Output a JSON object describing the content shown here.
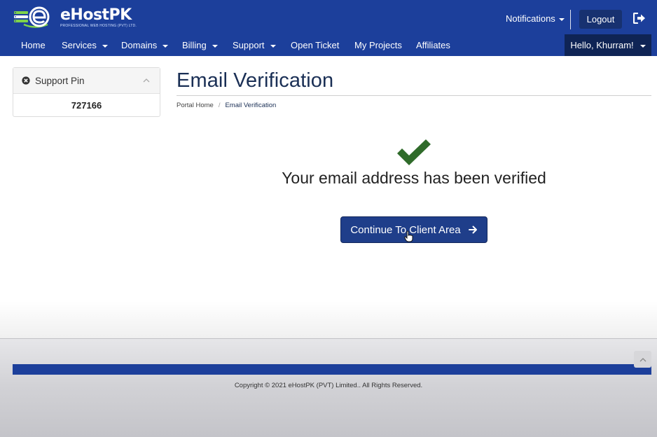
{
  "brand": {
    "name": "eHostPK",
    "tagline": "PROFESSIONAL WEB HOSTING (PVT) LTD."
  },
  "header": {
    "notifications_label": "Notifications",
    "logout_label": "Logout"
  },
  "nav": {
    "items": [
      {
        "label": "Home",
        "dropdown": false
      },
      {
        "label": "Services",
        "dropdown": true
      },
      {
        "label": "Domains",
        "dropdown": true
      },
      {
        "label": "Billing",
        "dropdown": true
      },
      {
        "label": "Support",
        "dropdown": true
      },
      {
        "label": "Open Ticket",
        "dropdown": false
      },
      {
        "label": "My Projects",
        "dropdown": false
      },
      {
        "label": "Affiliates",
        "dropdown": false
      }
    ],
    "account_label": "Hello, Khurram!"
  },
  "sidebar": {
    "panel_title": "Support Pin",
    "pin_value": "727166"
  },
  "main": {
    "title": "Email Verification",
    "breadcrumb": [
      "Portal Home",
      "Email Verification"
    ],
    "message": "Your email address has been verified",
    "button_label": "Continue To Client Area"
  },
  "footer": {
    "copyright": "Copyright © 2021 eHostPK (PVT) Limited.. All Rights Reserved."
  },
  "colors": {
    "brand_blue": "#1c3f9b",
    "dark_navy": "#0f2455",
    "success_green": "#2f6b2a",
    "button_blue": "#1f3e8a"
  },
  "icons": [
    "logo-icon",
    "exit-icon",
    "close-circle-icon",
    "chevron-up-icon",
    "checkmark-icon",
    "arrow-right-icon",
    "hand-cursor-icon",
    "caret-down-icon"
  ]
}
